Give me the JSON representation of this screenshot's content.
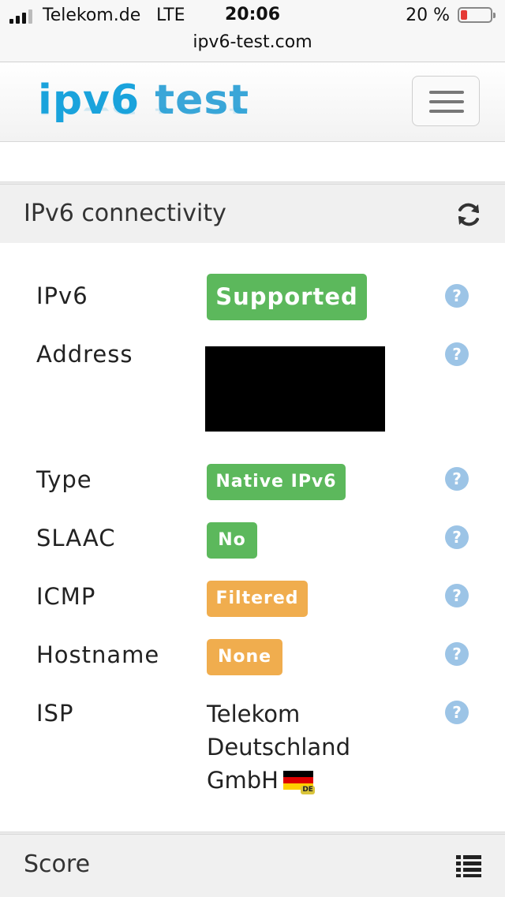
{
  "status_bar": {
    "carrier": "Telekom.de",
    "network": "LTE",
    "time": "20:06",
    "battery_text": "20 %",
    "battery_level": 0.2,
    "battery_color": "#e53935"
  },
  "browser": {
    "url": "ipv6-test.com"
  },
  "header": {
    "logo_part1": "ipv6",
    "logo_part2": "test",
    "menu_icon": "hamburger-menu-icon"
  },
  "connectivity": {
    "title": "IPv6 connectivity",
    "refresh_icon": "refresh-icon",
    "rows": {
      "ipv6": {
        "label": "IPv6",
        "value": "Supported",
        "status": "green"
      },
      "address": {
        "label": "Address",
        "value": ""
      },
      "type": {
        "label": "Type",
        "value": "Native IPv6",
        "status": "green"
      },
      "slaac": {
        "label": "SLAAC",
        "value": "No",
        "status": "green"
      },
      "icmp": {
        "label": "ICMP",
        "value": "Filtered",
        "status": "orange"
      },
      "hostname": {
        "label": "Hostname",
        "value": "None",
        "status": "orange"
      },
      "isp": {
        "label": "ISP",
        "line1": "Telekom",
        "line2": "Deutschland",
        "line3": "GmbH",
        "flag_tag": "DE"
      }
    },
    "help_icon_text": "?"
  },
  "score": {
    "title": "Score",
    "icon": "list-icon"
  },
  "colors": {
    "green": "#5cb85c",
    "orange": "#f0ad4e",
    "help": "#9cc4e6"
  }
}
